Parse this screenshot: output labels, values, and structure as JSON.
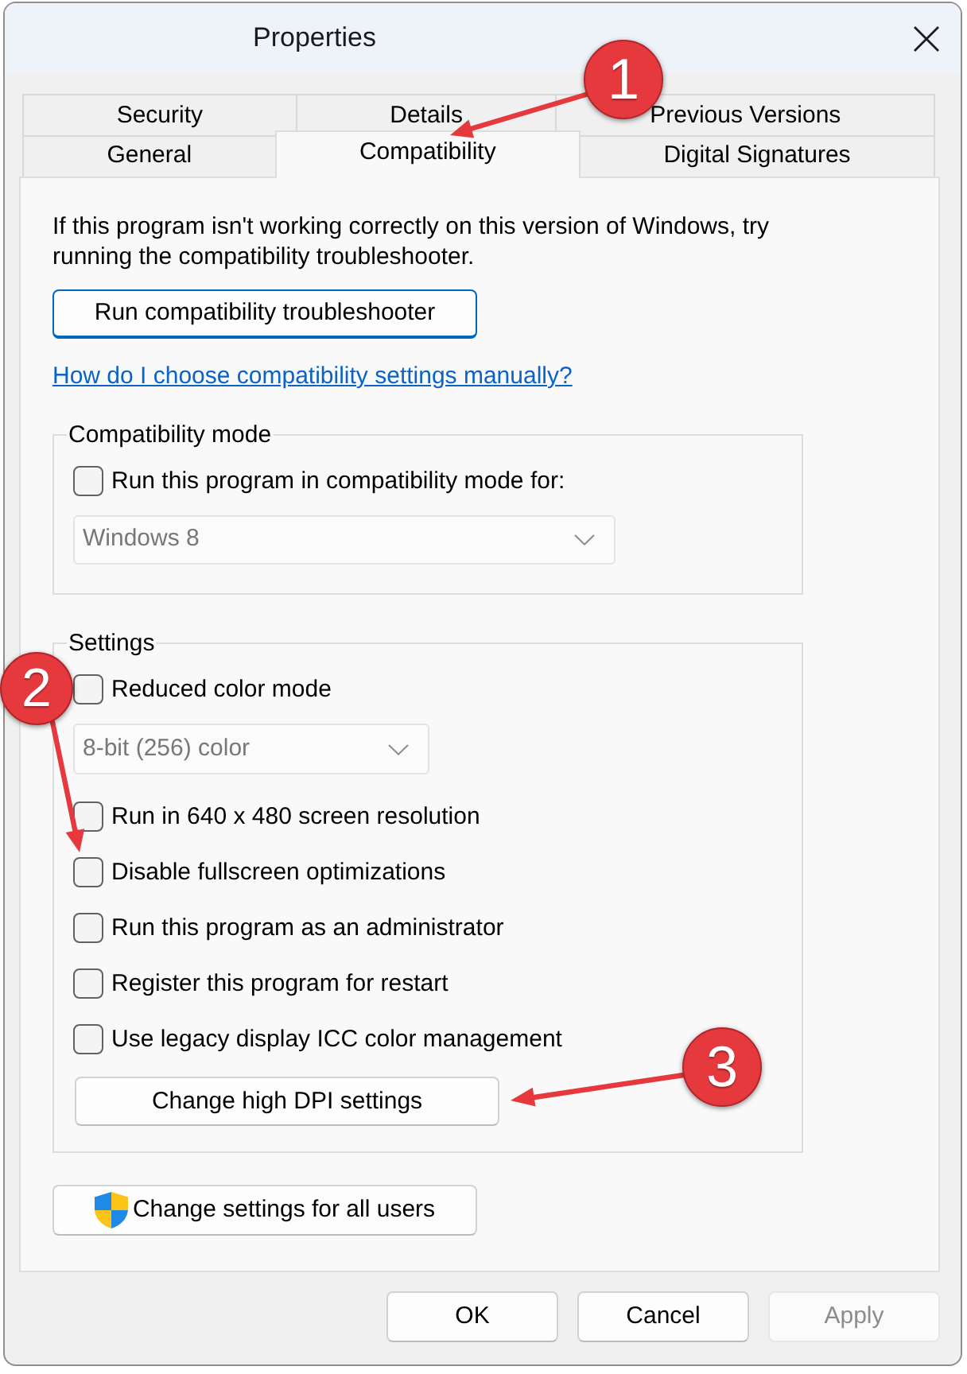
{
  "window": {
    "title": "Properties"
  },
  "tab_rows": [
    {
      "tabs": [
        {
          "label": "Security",
          "selected": false
        },
        {
          "label": "Details",
          "selected": false
        },
        {
          "label": "Previous Versions",
          "selected": false
        }
      ]
    },
    {
      "tabs": [
        {
          "label": "General",
          "selected": false
        },
        {
          "label": "Compatibility",
          "selected": true
        },
        {
          "label": "Digital Signatures",
          "selected": false
        }
      ]
    }
  ],
  "description": "If this program isn't working correctly on this version of Windows, try running the compatibility troubleshooter.",
  "troubleshooter_button": {
    "label": "Run compatibility troubleshooter",
    "focused": true
  },
  "help_link": "How do I choose compatibility settings manually?",
  "groups": [
    {
      "legend": "Compatibility mode",
      "items": [
        {
          "kind": "checkbox",
          "label": "Run this program in compatibility mode for:",
          "checked": false
        },
        {
          "kind": "dropdown",
          "value": "Windows 8",
          "disabled": true
        }
      ]
    },
    {
      "legend": "Settings",
      "items": [
        {
          "kind": "checkbox",
          "label": "Reduced color mode",
          "checked": false
        },
        {
          "kind": "dropdown",
          "value": "8-bit (256) color",
          "disabled": true
        },
        {
          "kind": "checkbox",
          "label": "Run in 640 x 480 screen resolution",
          "checked": false
        },
        {
          "kind": "checkbox",
          "label": "Disable fullscreen optimizations",
          "checked": false
        },
        {
          "kind": "checkbox",
          "label": "Run this program as an administrator",
          "checked": false
        },
        {
          "kind": "checkbox",
          "label": "Register this program for restart",
          "checked": false
        },
        {
          "kind": "checkbox",
          "label": "Use legacy display ICC color management",
          "checked": false
        },
        {
          "kind": "button",
          "label": "Change high DPI settings"
        }
      ]
    }
  ],
  "all_users_button": {
    "label": "Change settings for all users"
  },
  "buttons": [
    {
      "label": "OK",
      "disabled": false
    },
    {
      "label": "Cancel",
      "disabled": false
    },
    {
      "label": "Apply",
      "disabled": true
    }
  ],
  "annotations": [
    {
      "label": "1"
    },
    {
      "label": "2"
    },
    {
      "label": "3"
    }
  ]
}
